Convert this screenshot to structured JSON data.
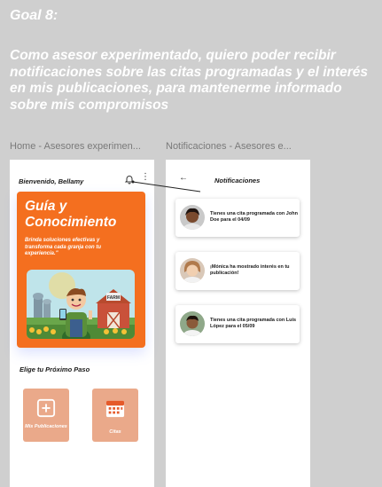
{
  "goal": {
    "title": "Goal 8:",
    "text": "Como asesor experimentado, quiero poder recibir notificaciones sobre las citas programadas y el interés en mis publicaciones, para mantenerme informado sobre mis compromisos"
  },
  "frames": {
    "home_label": "Home - Asesores experimen...",
    "notif_label": "Notificaciones - Asesores e..."
  },
  "home": {
    "welcome": "Bienvenido, Bellamy",
    "hero": {
      "title": "Guía y Conocimiento",
      "subtitle": "Brinda soluciones efectivas y transforma cada granja con tu experiencia.\"",
      "image_sign": "FARM"
    },
    "next_step": "Elige tu Próximo Paso",
    "tiles": [
      {
        "label": "Mis Publicaciones",
        "icon": "plus-square-icon"
      },
      {
        "label": "Citas",
        "icon": "calendar-icon"
      }
    ]
  },
  "notifications": {
    "title": "Notificaciones",
    "items": [
      {
        "text": "Tienes una cita programada con John Doe para el 04/09"
      },
      {
        "text": "¡Mónica ha mostrado interés en tu publicación!"
      },
      {
        "text": "Tienes una cita programada con Luis López para el 05/09"
      }
    ]
  },
  "colors": {
    "accent": "#f46f1f",
    "tile": "#eaa98a",
    "canvas": "#cfcfcf"
  }
}
